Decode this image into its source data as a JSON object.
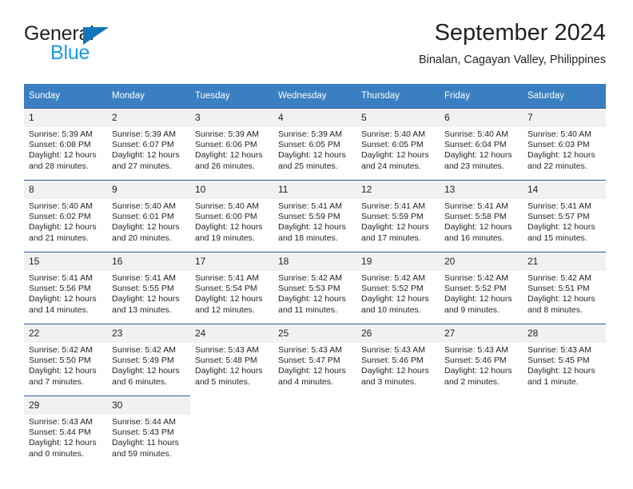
{
  "brand": {
    "name_dark": "General",
    "name_blue": "Blue",
    "triangle_color": "#1076bc",
    "blue_color": "#1b9ae0"
  },
  "header": {
    "title": "September 2024",
    "subtitle": "Binalan, Cagayan Valley, Philippines"
  },
  "theme": {
    "header_bg": "#3a7fc1",
    "header_text": "#ffffff",
    "daynum_bg": "#f1f1f1",
    "row_rule": "#2c5f8f",
    "text": "#231f20"
  },
  "labels": {
    "sunrise": "Sunrise:",
    "sunset": "Sunset:",
    "daylight": "Daylight:"
  },
  "weekdays": [
    "Sunday",
    "Monday",
    "Tuesday",
    "Wednesday",
    "Thursday",
    "Friday",
    "Saturday"
  ],
  "weeks": [
    [
      {
        "day": "1",
        "sunrise": "Sunrise: 5:39 AM",
        "sunset": "Sunset: 6:08 PM",
        "daylight1": "Daylight: 12 hours",
        "daylight2": "and 28 minutes."
      },
      {
        "day": "2",
        "sunrise": "Sunrise: 5:39 AM",
        "sunset": "Sunset: 6:07 PM",
        "daylight1": "Daylight: 12 hours",
        "daylight2": "and 27 minutes."
      },
      {
        "day": "3",
        "sunrise": "Sunrise: 5:39 AM",
        "sunset": "Sunset: 6:06 PM",
        "daylight1": "Daylight: 12 hours",
        "daylight2": "and 26 minutes."
      },
      {
        "day": "4",
        "sunrise": "Sunrise: 5:39 AM",
        "sunset": "Sunset: 6:05 PM",
        "daylight1": "Daylight: 12 hours",
        "daylight2": "and 25 minutes."
      },
      {
        "day": "5",
        "sunrise": "Sunrise: 5:40 AM",
        "sunset": "Sunset: 6:05 PM",
        "daylight1": "Daylight: 12 hours",
        "daylight2": "and 24 minutes."
      },
      {
        "day": "6",
        "sunrise": "Sunrise: 5:40 AM",
        "sunset": "Sunset: 6:04 PM",
        "daylight1": "Daylight: 12 hours",
        "daylight2": "and 23 minutes."
      },
      {
        "day": "7",
        "sunrise": "Sunrise: 5:40 AM",
        "sunset": "Sunset: 6:03 PM",
        "daylight1": "Daylight: 12 hours",
        "daylight2": "and 22 minutes."
      }
    ],
    [
      {
        "day": "8",
        "sunrise": "Sunrise: 5:40 AM",
        "sunset": "Sunset: 6:02 PM",
        "daylight1": "Daylight: 12 hours",
        "daylight2": "and 21 minutes."
      },
      {
        "day": "9",
        "sunrise": "Sunrise: 5:40 AM",
        "sunset": "Sunset: 6:01 PM",
        "daylight1": "Daylight: 12 hours",
        "daylight2": "and 20 minutes."
      },
      {
        "day": "10",
        "sunrise": "Sunrise: 5:40 AM",
        "sunset": "Sunset: 6:00 PM",
        "daylight1": "Daylight: 12 hours",
        "daylight2": "and 19 minutes."
      },
      {
        "day": "11",
        "sunrise": "Sunrise: 5:41 AM",
        "sunset": "Sunset: 5:59 PM",
        "daylight1": "Daylight: 12 hours",
        "daylight2": "and 18 minutes."
      },
      {
        "day": "12",
        "sunrise": "Sunrise: 5:41 AM",
        "sunset": "Sunset: 5:59 PM",
        "daylight1": "Daylight: 12 hours",
        "daylight2": "and 17 minutes."
      },
      {
        "day": "13",
        "sunrise": "Sunrise: 5:41 AM",
        "sunset": "Sunset: 5:58 PM",
        "daylight1": "Daylight: 12 hours",
        "daylight2": "and 16 minutes."
      },
      {
        "day": "14",
        "sunrise": "Sunrise: 5:41 AM",
        "sunset": "Sunset: 5:57 PM",
        "daylight1": "Daylight: 12 hours",
        "daylight2": "and 15 minutes."
      }
    ],
    [
      {
        "day": "15",
        "sunrise": "Sunrise: 5:41 AM",
        "sunset": "Sunset: 5:56 PM",
        "daylight1": "Daylight: 12 hours",
        "daylight2": "and 14 minutes."
      },
      {
        "day": "16",
        "sunrise": "Sunrise: 5:41 AM",
        "sunset": "Sunset: 5:55 PM",
        "daylight1": "Daylight: 12 hours",
        "daylight2": "and 13 minutes."
      },
      {
        "day": "17",
        "sunrise": "Sunrise: 5:41 AM",
        "sunset": "Sunset: 5:54 PM",
        "daylight1": "Daylight: 12 hours",
        "daylight2": "and 12 minutes."
      },
      {
        "day": "18",
        "sunrise": "Sunrise: 5:42 AM",
        "sunset": "Sunset: 5:53 PM",
        "daylight1": "Daylight: 12 hours",
        "daylight2": "and 11 minutes."
      },
      {
        "day": "19",
        "sunrise": "Sunrise: 5:42 AM",
        "sunset": "Sunset: 5:52 PM",
        "daylight1": "Daylight: 12 hours",
        "daylight2": "and 10 minutes."
      },
      {
        "day": "20",
        "sunrise": "Sunrise: 5:42 AM",
        "sunset": "Sunset: 5:52 PM",
        "daylight1": "Daylight: 12 hours",
        "daylight2": "and 9 minutes."
      },
      {
        "day": "21",
        "sunrise": "Sunrise: 5:42 AM",
        "sunset": "Sunset: 5:51 PM",
        "daylight1": "Daylight: 12 hours",
        "daylight2": "and 8 minutes."
      }
    ],
    [
      {
        "day": "22",
        "sunrise": "Sunrise: 5:42 AM",
        "sunset": "Sunset: 5:50 PM",
        "daylight1": "Daylight: 12 hours",
        "daylight2": "and 7 minutes."
      },
      {
        "day": "23",
        "sunrise": "Sunrise: 5:42 AM",
        "sunset": "Sunset: 5:49 PM",
        "daylight1": "Daylight: 12 hours",
        "daylight2": "and 6 minutes."
      },
      {
        "day": "24",
        "sunrise": "Sunrise: 5:43 AM",
        "sunset": "Sunset: 5:48 PM",
        "daylight1": "Daylight: 12 hours",
        "daylight2": "and 5 minutes."
      },
      {
        "day": "25",
        "sunrise": "Sunrise: 5:43 AM",
        "sunset": "Sunset: 5:47 PM",
        "daylight1": "Daylight: 12 hours",
        "daylight2": "and 4 minutes."
      },
      {
        "day": "26",
        "sunrise": "Sunrise: 5:43 AM",
        "sunset": "Sunset: 5:46 PM",
        "daylight1": "Daylight: 12 hours",
        "daylight2": "and 3 minutes."
      },
      {
        "day": "27",
        "sunrise": "Sunrise: 5:43 AM",
        "sunset": "Sunset: 5:46 PM",
        "daylight1": "Daylight: 12 hours",
        "daylight2": "and 2 minutes."
      },
      {
        "day": "28",
        "sunrise": "Sunrise: 5:43 AM",
        "sunset": "Sunset: 5:45 PM",
        "daylight1": "Daylight: 12 hours",
        "daylight2": "and 1 minute."
      }
    ],
    [
      {
        "day": "29",
        "sunrise": "Sunrise: 5:43 AM",
        "sunset": "Sunset: 5:44 PM",
        "daylight1": "Daylight: 12 hours",
        "daylight2": "and 0 minutes."
      },
      {
        "day": "30",
        "sunrise": "Sunrise: 5:44 AM",
        "sunset": "Sunset: 5:43 PM",
        "daylight1": "Daylight: 11 hours",
        "daylight2": "and 59 minutes."
      },
      {
        "day": "",
        "sunrise": "",
        "sunset": "",
        "daylight1": "",
        "daylight2": ""
      },
      {
        "day": "",
        "sunrise": "",
        "sunset": "",
        "daylight1": "",
        "daylight2": ""
      },
      {
        "day": "",
        "sunrise": "",
        "sunset": "",
        "daylight1": "",
        "daylight2": ""
      },
      {
        "day": "",
        "sunrise": "",
        "sunset": "",
        "daylight1": "",
        "daylight2": ""
      },
      {
        "day": "",
        "sunrise": "",
        "sunset": "",
        "daylight1": "",
        "daylight2": ""
      }
    ]
  ]
}
